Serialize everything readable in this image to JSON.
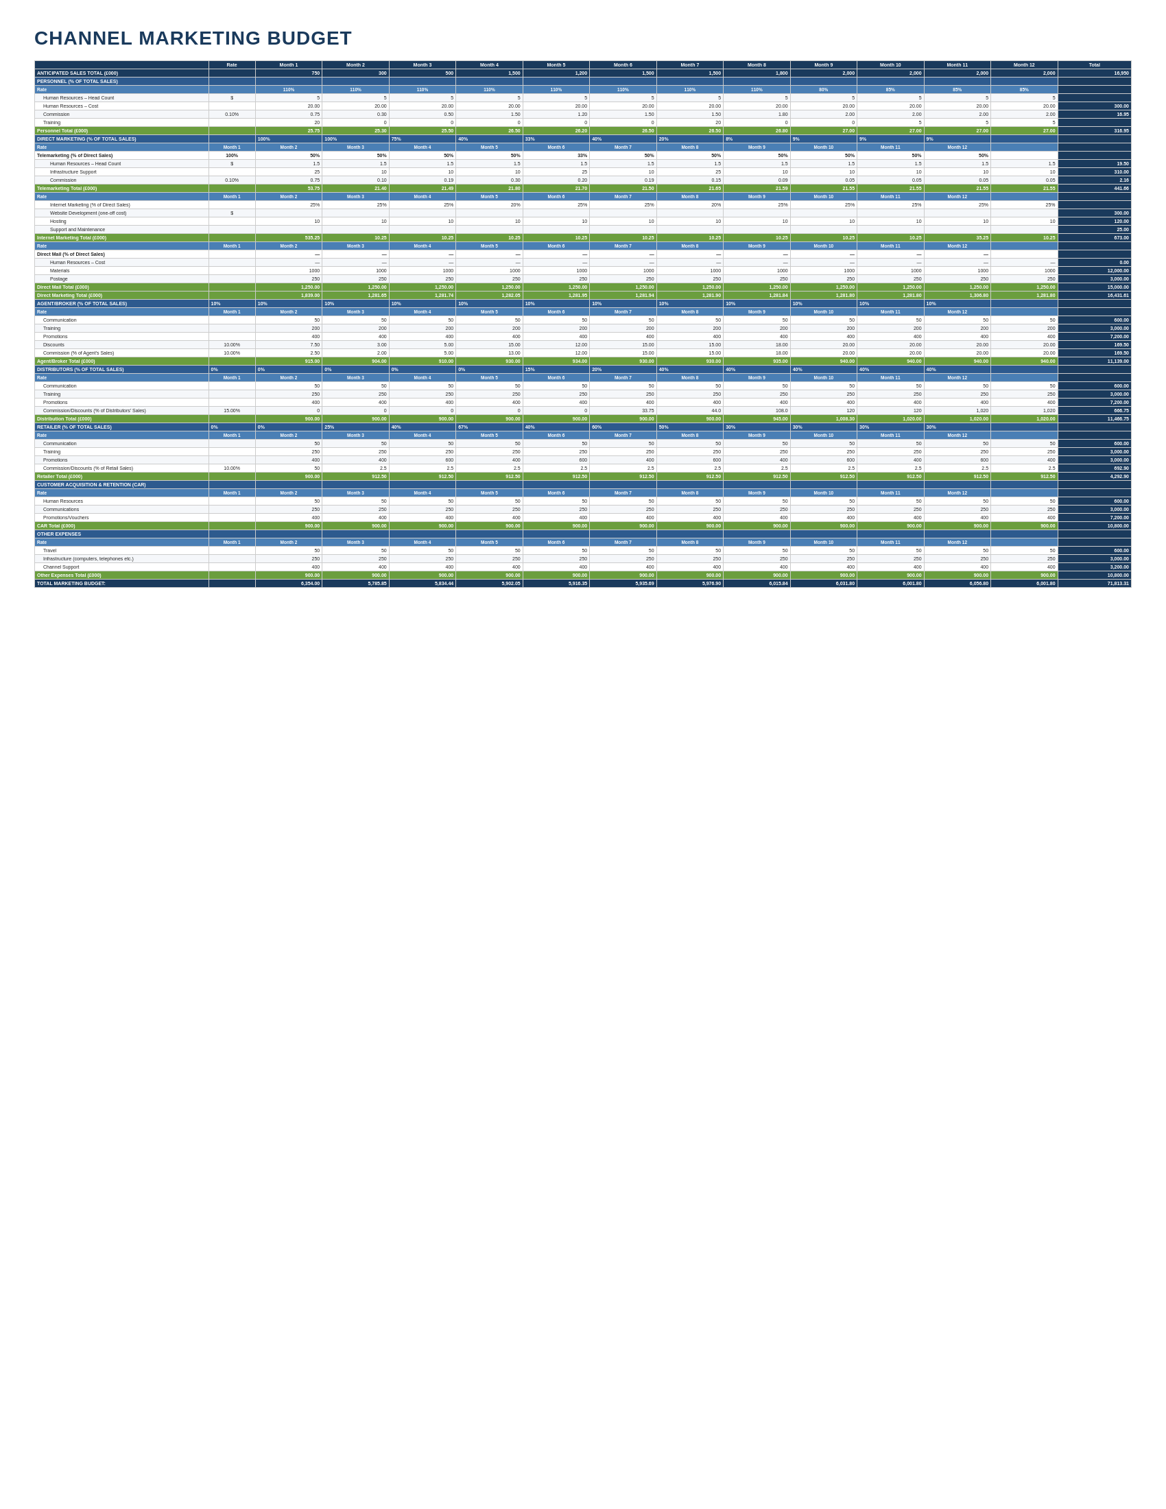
{
  "title": "CHANNEL MARKETING BUDGET",
  "columns": {
    "headers": [
      "",
      "Rate",
      "Month 1",
      "Month 2",
      "Month 3",
      "Month 4",
      "Month 5",
      "Month 6",
      "Month 7",
      "Month 8",
      "Month 9",
      "Month 10",
      "Month 11",
      "Month 12",
      "Total"
    ]
  },
  "sections": {
    "anticipated": {
      "label": "ANTICIPATED SALES TOTAL (£000)",
      "values": [
        "750",
        "300",
        "500",
        "1,500",
        "1,200",
        "1,500",
        "1,500",
        "1,800",
        "2,000",
        "2,000",
        "2,000",
        "2,000"
      ],
      "total": "16,950"
    },
    "personnel": {
      "header": "PERSONNEL (% OF TOTAL SALES)",
      "rate_row": [
        "110%",
        "110%",
        "110%",
        "110%",
        "110%",
        "110%",
        "110%",
        "110%",
        "80%",
        "85%",
        "85%",
        "85%"
      ],
      "rows": [
        {
          "label": "Human Resources – Head Count",
          "rate": "$",
          "values": [
            "5",
            "5",
            "5",
            "5",
            "5",
            "5",
            "5",
            "5",
            "5",
            "5",
            "5",
            "5"
          ],
          "total": ""
        },
        {
          "label": "Human Resources – Cost",
          "rate": "",
          "values": [
            "20.00",
            "20.00",
            "20.00",
            "20.00",
            "20.00",
            "20.00",
            "20.00",
            "20.00",
            "20.00",
            "20.00",
            "20.00",
            "20.00"
          ],
          "total": "300.00"
        },
        {
          "label": "Commission",
          "rate": "0.10%",
          "values": [
            "0.75",
            "0.30",
            "0.50",
            "1.50",
            "1.20",
            "1.50",
            "1.50",
            "1.80",
            "2.00",
            "2.00",
            "2.00",
            "2.00"
          ],
          "total": "16.95"
        },
        {
          "label": "Training",
          "rate": "",
          "values": [
            "20",
            "0",
            "0",
            "0",
            "0",
            "0",
            "20",
            "0",
            "0",
            "5",
            "5",
            "5"
          ],
          "total": ""
        },
        {
          "label": "Personnel Total (£000)",
          "rate": "",
          "values": [
            "25.75",
            "25.30",
            "25.50",
            "26.50",
            "26.20",
            "26.50",
            "26.50",
            "26.80",
            "27.00",
            "27.00",
            "27.00",
            "27.00"
          ],
          "total": "316.95"
        }
      ]
    },
    "direct_marketing": {
      "header": "DIRECT MARKETING (% OF TOTAL SALES)",
      "rate_row_label": "Rate",
      "telemarketing": {
        "header": "Telemarketing (% of Direct Sales)",
        "rate": "100%",
        "sub_rates": [
          "50%",
          "50%",
          "50%",
          "50%",
          "33%",
          "50%",
          "50%",
          "50%",
          "50%",
          "50%",
          "50%"
        ],
        "rows": [
          {
            "label": "Human Resources – Head Count",
            "rate": "$",
            "values": [
              "1.5",
              "1.5",
              "1.5",
              "1.5",
              "1.5",
              "1.5",
              "1.5",
              "1.5",
              "1.5",
              "1.5",
              "1.5",
              "1.5"
            ],
            "total": "19.50"
          },
          {
            "label": "Infrastructure Support",
            "rate": "",
            "values": [
              "25",
              "10",
              "10",
              "10",
              "25",
              "10",
              "25",
              "10",
              "10",
              "10",
              "10",
              "10"
            ],
            "total": "310.00"
          },
          {
            "label": "Commission",
            "rate": "0.10%",
            "values": [
              "0.75",
              "0.10",
              "0.19",
              "0.30",
              "0.20",
              "0.19",
              "0.15",
              "0.09",
              "0.05",
              "0.05",
              "0.05",
              "0.05"
            ],
            "total": "2.16"
          }
        ],
        "total_row": {
          "label": "Telemarketing Total (£000)",
          "values": [
            "53.75",
            "21.40",
            "21.49",
            "21.80",
            "21.70",
            "21.50",
            "21.65",
            "21.59",
            "21.55",
            "21.55",
            "21.55",
            "21.55"
          ],
          "total": "441.66"
        }
      },
      "internet": {
        "header": "Internet Marketing",
        "rows": [
          {
            "label": "Internet Marketing (% of Direct Sales)",
            "rate": "",
            "values": [
              "25%",
              "25%",
              "25%",
              "20%",
              "25%",
              "25%",
              "20%",
              "25%",
              "25%",
              "25%",
              "25%",
              "25%"
            ],
            "total": ""
          },
          {
            "label": "Website Development (one-off cost)",
            "rate": "$",
            "values": [
              "",
              "",
              "",
              "",
              "",
              "",
              "",
              "",
              "",
              "",
              "",
              ""
            ],
            "total": "300.00"
          },
          {
            "label": "Hosting",
            "rate": "",
            "values": [
              "10",
              "10",
              "10",
              "10",
              "10",
              "10",
              "10",
              "10",
              "10",
              "10",
              "10",
              "10"
            ],
            "total": "120.00"
          },
          {
            "label": "Support and Maintenance",
            "rate": "",
            "values": [
              "",
              "",
              "",
              "",
              "",
              "",
              "",
              "",
              "",
              "",
              "",
              ""
            ],
            "total": "25.00"
          }
        ],
        "total_row": {
          "label": "Internet Marketing Total (£000)",
          "values": [
            "535.25",
            "10.25",
            "10.25",
            "10.25",
            "10.25",
            "10.25",
            "10.25",
            "10.25",
            "10.25",
            "10.25",
            "35.25",
            "10.25"
          ],
          "total": "673.00"
        }
      },
      "direct_mail": {
        "header": "Direct Mail (% of Direct Sales)",
        "rows": [
          {
            "label": "Human Resources – Cost",
            "rate": "",
            "values": [
              "—",
              "—",
              "—",
              "—",
              "—",
              "—",
              "—",
              "—",
              "—",
              "—",
              "—",
              "—"
            ],
            "total": "0.00"
          },
          {
            "label": "Materials",
            "rate": "",
            "values": [
              "1000",
              "1000",
              "1000",
              "1000",
              "1000",
              "1000",
              "1000",
              "1000",
              "1000",
              "1000",
              "1000",
              "1000"
            ],
            "total": "12,000.00"
          },
          {
            "label": "Postage",
            "rate": "",
            "values": [
              "250",
              "250",
              "250",
              "250",
              "250",
              "250",
              "250",
              "250",
              "250",
              "250",
              "250",
              "250"
            ],
            "total": "3,000.00"
          }
        ],
        "total_row": {
          "label": "Direct Mail Total (£000)",
          "values": [
            "1,250.00",
            "1,250.00",
            "1,250.00",
            "1,250.00",
            "1,250.00",
            "1,250.00",
            "1,250.00",
            "1,250.00",
            "1,250.00",
            "1,250.00",
            "1,250.00",
            "1,250.00"
          ],
          "total": "15,000.00"
        }
      },
      "dm_total": {
        "label": "Direct Marketing Total (£000)",
        "values": [
          "1,839.00",
          "1,281.65",
          "1,281.74",
          "1,282.05",
          "1,281.95",
          "1,281.94",
          "1,281.90",
          "1,281.84",
          "1,281.80",
          "1,281.80",
          "1,306.80",
          "1,281.80"
        ],
        "total": "16,431.61"
      }
    },
    "agent_broker": {
      "header": "AGENT/BROKER (% OF TOTAL SALES)",
      "rate": "10%",
      "rows": [
        {
          "label": "Communication",
          "rate": "",
          "values": [
            "50",
            "50",
            "50",
            "50",
            "50",
            "50",
            "50",
            "50",
            "50",
            "50",
            "50",
            "50"
          ],
          "total": "600.00"
        },
        {
          "label": "Training",
          "rate": "",
          "values": [
            "200",
            "200",
            "200",
            "200",
            "200",
            "200",
            "200",
            "200",
            "200",
            "200",
            "200",
            "200"
          ],
          "total": "3,000.00"
        },
        {
          "label": "Promotions",
          "rate": "",
          "values": [
            "400",
            "400",
            "400",
            "400",
            "400",
            "400",
            "400",
            "400",
            "400",
            "400",
            "400",
            "400"
          ],
          "total": "7,200.00"
        },
        {
          "label": "Discounts",
          "rate": "10.00%",
          "values": [
            "7.50",
            "3.00",
            "5.00",
            "15.00",
            "12.00",
            "15.00",
            "15.00",
            "18.00",
            "20.00",
            "20.00",
            "20.00",
            "20.00"
          ],
          "total": "169.50"
        },
        {
          "label": "Commission (% of Agent's Sales)",
          "rate": "10.00%",
          "values": [
            "2.50",
            "2.00",
            "5.00",
            "13.00",
            "12.00",
            "15.00",
            "15.00",
            "18.00",
            "20.00",
            "20.00",
            "20.00",
            "20.00"
          ],
          "total": "169.50"
        }
      ],
      "total_row": {
        "label": "Agent/Broker Total (£000)",
        "values": [
          "915.00",
          "904.00",
          "910.00",
          "930.00",
          "934.00",
          "930.00",
          "930.00",
          "935.00",
          "940.00",
          "940.00",
          "940.00",
          "940.00"
        ],
        "total": "11,139.00"
      }
    },
    "distributors": {
      "header": "DISTRIBUTORS (% OF TOTAL SALES)",
      "rate": "0%",
      "rows": [
        {
          "label": "Communication",
          "rate": "",
          "values": [
            "50",
            "50",
            "50",
            "50",
            "50",
            "50",
            "50",
            "50",
            "50",
            "50",
            "50",
            "50"
          ],
          "total": "600.00"
        },
        {
          "label": "Training",
          "rate": "",
          "values": [
            "250",
            "250",
            "250",
            "250",
            "250",
            "250",
            "250",
            "250",
            "250",
            "250",
            "250",
            "250"
          ],
          "total": "3,000.00"
        },
        {
          "label": "Promotions",
          "rate": "",
          "values": [
            "400",
            "400",
            "400",
            "400",
            "400",
            "400",
            "400",
            "400",
            "400",
            "400",
            "400",
            "400"
          ],
          "total": "7,200.00"
        },
        {
          "label": "Commission/Discounts (% of Distributors' Sales)",
          "rate": "15.00%",
          "values": [
            "0",
            "0",
            "0",
            "0",
            "0",
            "33.75",
            "44.0",
            "108.0",
            "120",
            "120",
            "1,020",
            "1,020"
          ],
          "total": "666.75"
        }
      ],
      "total_row": {
        "label": "Distribution Total (£000)",
        "values": [
          "900.00",
          "900.00",
          "900.00",
          "900.00",
          "900.00",
          "900.00",
          "900.00",
          "945.00",
          "1,008.30",
          "1,020.00",
          "1,020.00",
          "1,020.00"
        ],
        "total": "11,466.75"
      }
    },
    "retailer": {
      "header": "RETAILER (% OF TOTAL SALES)",
      "rate": "0%",
      "sub_rates": [
        "0%",
        "25%",
        "40%",
        "67%",
        "40%",
        "60%",
        "50%",
        "30%",
        "30%",
        "30%",
        "30%"
      ],
      "rows": [
        {
          "label": "Communication",
          "rate": "",
          "values": [
            "50",
            "50",
            "50",
            "50",
            "50",
            "50",
            "50",
            "50",
            "50",
            "50",
            "50",
            "50"
          ],
          "total": "600.00"
        },
        {
          "label": "Training",
          "rate": "",
          "values": [
            "250",
            "250",
            "250",
            "250",
            "250",
            "250",
            "250",
            "250",
            "250",
            "250",
            "250",
            "250"
          ],
          "total": "3,000.00"
        },
        {
          "label": "Promotions",
          "rate": "",
          "values": [
            "400",
            "400",
            "600",
            "400",
            "600",
            "400",
            "600",
            "400",
            "600",
            "400",
            "600",
            "400"
          ],
          "total": "3,000.00"
        },
        {
          "label": "Commission/Discounts (% of Retail Sales)",
          "rate": "10.00%",
          "values": [
            "50",
            "2.5",
            "2.5",
            "2.5",
            "2.5",
            "2.5",
            "2.5",
            "2.5",
            "2.5",
            "2.5",
            "2.5",
            "2.5"
          ],
          "total": "692.90"
        }
      ],
      "total_row": {
        "label": "Retailer Total (£000)",
        "values": [
          "900.00",
          "912.50",
          "912.50",
          "912.50",
          "912.50",
          "912.50",
          "912.50",
          "912.50",
          "912.50",
          "912.50",
          "912.50",
          "912.50"
        ],
        "total": "4,292.90"
      }
    },
    "car": {
      "header": "CUSTOMER ACQUISITION & RETENTION (CAR)",
      "rows": [
        {
          "label": "Human Resources",
          "rate": "",
          "values": [
            "50",
            "50",
            "50",
            "50",
            "50",
            "50",
            "50",
            "50",
            "50",
            "50",
            "50",
            "50"
          ],
          "total": "600.00"
        },
        {
          "label": "Communications",
          "rate": "",
          "values": [
            "250",
            "250",
            "250",
            "250",
            "250",
            "250",
            "250",
            "250",
            "250",
            "250",
            "250",
            "250"
          ],
          "total": "3,000.00"
        },
        {
          "label": "Promotions/Vouchers",
          "rate": "",
          "values": [
            "400",
            "400",
            "400",
            "400",
            "400",
            "400",
            "400",
            "400",
            "400",
            "400",
            "400",
            "400"
          ],
          "total": "7,200.00"
        }
      ],
      "total_row": {
        "label": "CAR Total (£000)",
        "values": [
          "900.00",
          "900.00",
          "900.00",
          "900.00",
          "900.00",
          "900.00",
          "900.00",
          "900.00",
          "900.00",
          "900.00",
          "900.00",
          "900.00"
        ],
        "total": "10,800.00"
      }
    },
    "other_expenses": {
      "header": "OTHER EXPENSES",
      "rows": [
        {
          "label": "Travel",
          "rate": "",
          "values": [
            "50",
            "50",
            "50",
            "50",
            "50",
            "50",
            "50",
            "50",
            "50",
            "50",
            "50",
            "50"
          ],
          "total": "600.00"
        },
        {
          "label": "Infrastructure (computers, telephones etc.)",
          "rate": "",
          "values": [
            "250",
            "250",
            "250",
            "250",
            "250",
            "250",
            "250",
            "250",
            "250",
            "250",
            "250",
            "250"
          ],
          "total": "3,000.00"
        },
        {
          "label": "Channel Support",
          "rate": "",
          "values": [
            "400",
            "400",
            "400",
            "400",
            "400",
            "400",
            "400",
            "400",
            "400",
            "400",
            "400",
            "400"
          ],
          "total": "3,200.00"
        }
      ],
      "total_row": {
        "label": "Other Expenses Total (£000)",
        "values": [
          "900.00",
          "900.00",
          "900.00",
          "900.00",
          "900.00",
          "900.00",
          "900.00",
          "900.00",
          "900.00",
          "900.00",
          "900.00",
          "900.00"
        ],
        "total": "10,800.00"
      }
    },
    "grand_total": {
      "label": "TOTAL MARKETING BUDGET:",
      "values": [
        "6,354.00",
        "5,785.85",
        "5,834.44",
        "5,902.05",
        "5,916.35",
        "5,935.69",
        "5,976.90",
        "6,015.84",
        "6,031.80",
        "6,001.80",
        "6,056.80",
        "6,001.80"
      ],
      "total": "71,813.31"
    }
  }
}
